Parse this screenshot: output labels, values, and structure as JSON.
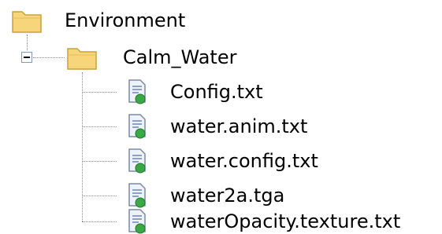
{
  "tree": {
    "root": {
      "label": "Environment",
      "icon": "folder-icon"
    },
    "folder": {
      "label": "Calm_Water",
      "icon": "folder-icon",
      "expanded": true
    },
    "files": [
      {
        "label": "Config.txt",
        "icon": "file-icon"
      },
      {
        "label": "water.anim.txt",
        "icon": "file-icon"
      },
      {
        "label": "water.config.txt",
        "icon": "file-icon"
      },
      {
        "label": "water2a.tga",
        "icon": "file-icon"
      },
      {
        "label": "waterOpacity.texture.txt",
        "icon": "file-icon"
      }
    ],
    "colors": {
      "folder_fill": "#f7d57b",
      "folder_stroke": "#c8a13a",
      "file_accent": "#39a845",
      "connector": "#8a8a8a"
    }
  }
}
